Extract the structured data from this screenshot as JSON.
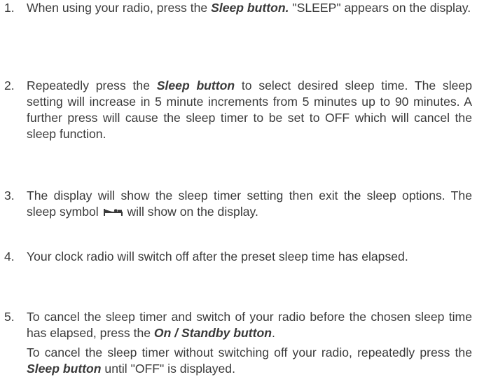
{
  "steps": [
    {
      "number": "1.",
      "p1": {
        "a": "When using your radio, press the ",
        "b": "Sleep button.",
        "c": " \"SLEEP\" appears on the display."
      }
    },
    {
      "number": "2.",
      "p1": {
        "a": "Repeatedly press the ",
        "b": "Sleep button",
        "c": " to select desired sleep time. The sleep setting will increase in 5 minute increments from 5 minutes up to 90 minutes. A further press will cause the sleep timer to be set to OFF which will cancel the sleep function."
      }
    },
    {
      "number": "3.",
      "p1": {
        "a": "The display will show the sleep timer setting then exit the sleep options. The sleep symbol ",
        "c": " will show on the display."
      }
    },
    {
      "number": "4.",
      "p1": {
        "a": "Your clock radio will switch off after the preset sleep time has elapsed."
      }
    },
    {
      "number": "5.",
      "p1": {
        "a": "To cancel the sleep timer and switch of your radio before the chosen sleep time has elapsed, press the ",
        "b": "On / Standby button",
        "c": "."
      },
      "p2": {
        "a": "To cancel the sleep timer without switching off your radio, repeatedly press the ",
        "b": "Sleep button",
        "c": " until \"OFF\" is displayed."
      }
    }
  ],
  "icons": {
    "sleep_symbol": "bed-icon"
  }
}
